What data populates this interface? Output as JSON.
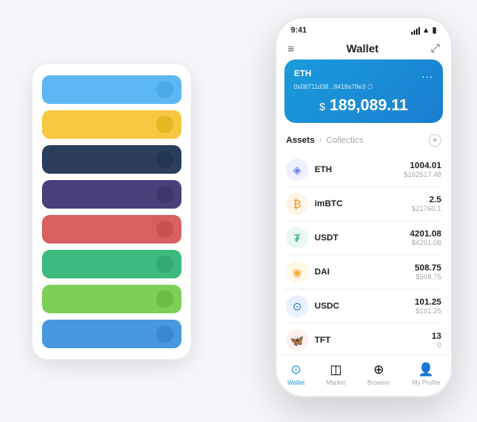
{
  "scene": {
    "background_color": "#f5f7fa"
  },
  "back_panel": {
    "strips": [
      {
        "color": "#5bb8f5",
        "dot_color": "#3a9de0"
      },
      {
        "color": "#f5c842",
        "dot_color": "#d4a800"
      },
      {
        "color": "#2c3e5c",
        "dot_color": "#1a2d47"
      },
      {
        "color": "#4a3f7a",
        "dot_color": "#332d5e"
      },
      {
        "color": "#d96060",
        "dot_color": "#b84444"
      },
      {
        "color": "#3dba7e",
        "dot_color": "#2a9960"
      },
      {
        "color": "#7ecf55",
        "dot_color": "#5aae30"
      },
      {
        "color": "#4898e0",
        "dot_color": "#2a78c2"
      }
    ]
  },
  "phone": {
    "status_bar": {
      "time": "9:41",
      "signal": "●●●",
      "wifi": "WiFi",
      "battery": "🔋"
    },
    "nav": {
      "menu_icon": "≡",
      "title": "Wallet",
      "expand_icon": "⤢"
    },
    "eth_card": {
      "label": "ETH",
      "dots": "...",
      "address": "0x08711d38...8418a78e3  ⬡",
      "balance_currency": "$",
      "balance": "189,089.11"
    },
    "assets_tabs": {
      "active": "Assets",
      "separator": "/",
      "inactive": "Collectics",
      "add_icon": "+"
    },
    "asset_rows": [
      {
        "icon": "◈",
        "icon_color": "#627eea",
        "bg_color": "#eef0ff",
        "name": "ETH",
        "amount": "1004.01",
        "usd": "$162517.48"
      },
      {
        "icon": "₿",
        "icon_color": "#f7931a",
        "bg_color": "#fff4e8",
        "name": "imBTC",
        "amount": "2.5",
        "usd": "$21760.1"
      },
      {
        "icon": "₮",
        "icon_color": "#26a17b",
        "bg_color": "#e8f8f3",
        "name": "USDT",
        "amount": "4201.08",
        "usd": "$4201.08"
      },
      {
        "icon": "◉",
        "icon_color": "#f5ac37",
        "bg_color": "#fff8e8",
        "name": "DAI",
        "amount": "508.75",
        "usd": "$508.75"
      },
      {
        "icon": "⊙",
        "icon_color": "#2775ca",
        "bg_color": "#e8f1ff",
        "name": "USDC",
        "amount": "101.25",
        "usd": "$101.25"
      },
      {
        "icon": "🦋",
        "icon_color": "#ff6b6b",
        "bg_color": "#fff0f0",
        "name": "TFT",
        "amount": "13",
        "usd": "0"
      }
    ],
    "bottom_nav": [
      {
        "icon": "⊙",
        "label": "Wallet",
        "active": true
      },
      {
        "icon": "📈",
        "label": "Market",
        "active": false
      },
      {
        "icon": "🌐",
        "label": "Browser",
        "active": false
      },
      {
        "icon": "👤",
        "label": "My Profile",
        "active": false
      }
    ]
  }
}
